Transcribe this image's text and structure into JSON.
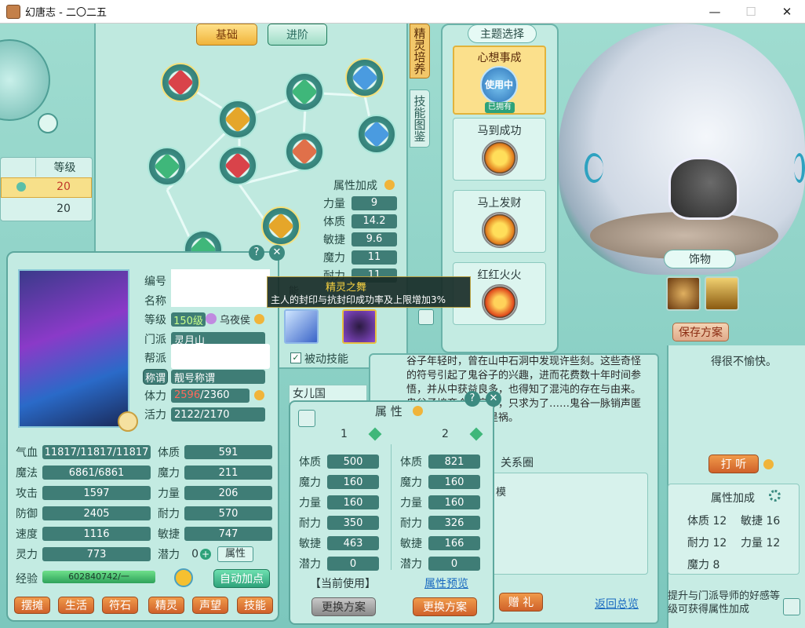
{
  "window": {
    "title": "幻唐志 - 二〇二五"
  },
  "spirit": {
    "tabs": [
      "基础",
      "进阶"
    ],
    "side_tabs": [
      "精灵培养",
      "技能图鉴"
    ],
    "level_table": {
      "header": "等级",
      "rows": [
        "20",
        "20"
      ]
    },
    "bonus": {
      "title": "属性加成",
      "rows": [
        {
          "label": "力量",
          "value": "9"
        },
        {
          "label": "体质",
          "value": "14.2"
        },
        {
          "label": "敏捷",
          "value": "9.6"
        },
        {
          "label": "魔力",
          "value": "11"
        },
        {
          "label": "耐力",
          "value": "11"
        }
      ]
    },
    "skill": {
      "name": "精灵之舞",
      "desc": "主人的封印与抗封印成功率及上限增加3%"
    },
    "passive_label": "被动技能",
    "partial_text": "能"
  },
  "theme": {
    "title": "主题选择",
    "items": [
      {
        "name": "心想事成",
        "badge": "使用中",
        "status": "已拥有"
      },
      {
        "name": "马到成功"
      },
      {
        "name": "马上发财"
      },
      {
        "name": "红红火火"
      }
    ],
    "ornament_label": "饰物",
    "save_label": "保存方案"
  },
  "character": {
    "labels": {
      "id": "编号",
      "name": "名称",
      "level": "等级",
      "school": "门派",
      "gang": "帮派",
      "title": "称谓",
      "hp": "体力",
      "vitality": "活力"
    },
    "level_value": "150级",
    "mount": "乌夜侯",
    "school_value": "灵月山",
    "title_value": "靓号称谓",
    "hp_current": "2596",
    "hp_max": "/2360",
    "vitality_value": "2122/2170",
    "stats_left": [
      {
        "label": "气血",
        "value": "11817/11817/11817"
      },
      {
        "label": "魔法",
        "value": "6861/6861"
      },
      {
        "label": "攻击",
        "value": "1597"
      },
      {
        "label": "防御",
        "value": "2405"
      },
      {
        "label": "速度",
        "value": "1116"
      },
      {
        "label": "灵力",
        "value": "773"
      }
    ],
    "stats_right": [
      {
        "label": "体质",
        "value": "591"
      },
      {
        "label": "魔力",
        "value": "211"
      },
      {
        "label": "力量",
        "value": "206"
      },
      {
        "label": "耐力",
        "value": "570"
      },
      {
        "label": "敏捷",
        "value": "747"
      }
    ],
    "potential_label": "潜力",
    "potential_value": "0",
    "attr_button": "属性",
    "exp_label": "经验",
    "exp_value": "602840742/一",
    "auto_button": "自动加点",
    "bottom_buttons": [
      "摆摊",
      "生活",
      "符石",
      "精灵",
      "声望",
      "技能"
    ]
  },
  "attr_panel": {
    "title": "属 性",
    "col_headers": [
      "1",
      "2"
    ],
    "labels": [
      "体质",
      "魔力",
      "力量",
      "耐力",
      "敏捷",
      "潜力"
    ],
    "col1": [
      "500",
      "160",
      "160",
      "350",
      "463",
      "0"
    ],
    "col2": [
      "821",
      "160",
      "160",
      "326",
      "166",
      "0"
    ],
    "current_use": "【当前使用】",
    "preview": "属性预览",
    "switch_btn": "更换方案"
  },
  "story": {
    "text": "谷子年轻时，曾在山中石洞中发现许些刻。这些奇怪的符号引起了鬼谷子的兴趣，进而花费数十年时间参悟，并从中获益良多，也得知了混沌的存在与由来。鬼谷子培育众多良才，只求为了……鬼谷一脉销声匿迹许久，而……福是祸。",
    "relation": "关系圈",
    "relation_snippet": "模",
    "region_tab": "女儿国",
    "gift_btn": "赠 礼",
    "back_link": "返回总览"
  },
  "right": {
    "mood": "得很不愉快。",
    "listen_btn": "打 听",
    "bonus_title": "属性加成",
    "bonus": [
      {
        "label": "体质",
        "value": "12"
      },
      {
        "label": "敏捷",
        "value": "16"
      },
      {
        "label": "耐力",
        "value": "12"
      },
      {
        "label": "力量",
        "value": "12"
      },
      {
        "label": "魔力",
        "value": "8"
      }
    ],
    "hint": "提升与门派导师的好感等级可获得属性加成"
  }
}
